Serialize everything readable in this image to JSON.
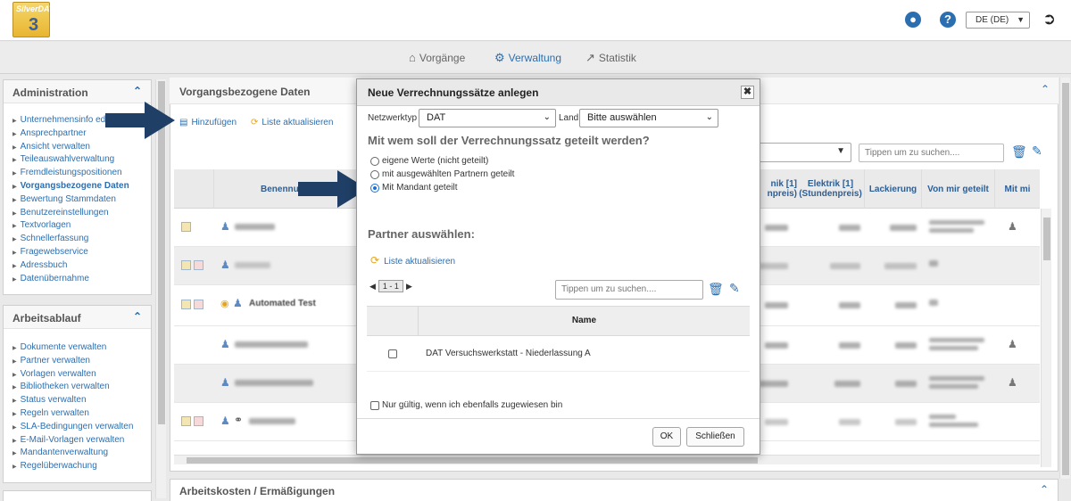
{
  "app": {
    "logo_text": "SilverDAT",
    "logo_number": "3",
    "language": "DE (DE)"
  },
  "nav": {
    "items": [
      "Vorgänge",
      "Verwaltung",
      "Statistik"
    ],
    "active": "Verwaltung"
  },
  "sidebar": {
    "administration": {
      "title": "Administration",
      "items": [
        "Unternehmensinfo editieren",
        "Ansprechpartner",
        "Ansicht verwalten",
        "Teileauswahlverwaltung",
        "Fremdleistungspositionen",
        "Vorgangsbezogene Daten",
        "Bewertung Stammdaten",
        "Benutzereinstellungen",
        "Textvorlagen",
        "Schnellerfassung",
        "Fragewebservice",
        "Adressbuch",
        "Datenübernahme"
      ],
      "active": "Vorgangsbezogene Daten"
    },
    "arbeitsablauf": {
      "title": "Arbeitsablauf",
      "items": [
        "Dokumente verwalten",
        "Partner verwalten",
        "Vorlagen verwalten",
        "Bibliotheken verwalten",
        "Status verwalten",
        "Regeln verwalten",
        "SLA-Bedingungen verwalten",
        "E-Mail-Vorlagen verwalten",
        "Mandantenverwaltung",
        "Regelüberwachung"
      ]
    }
  },
  "main": {
    "title": "Vorgangsbezogene Daten",
    "add_label": "Hinzufügen",
    "refresh_label": "Liste aktualisieren",
    "search_placeholder": "Tippen um zu suchen....",
    "columns": [
      "Benennung",
      "Elektrik [1] (Stundenpreis)",
      "Lackierung",
      "Von mir geteilt",
      "Mit mi"
    ],
    "col_partial": [
      "nik [1]",
      "npreis)"
    ],
    "row3_name": "Automated Test"
  },
  "bottom_panel": {
    "title": "Arbeitskosten / Ermäßigungen"
  },
  "modal": {
    "title": "Neue Verrechnungssätze anlegen",
    "netzwerktyp_label": "Netzwerktyp",
    "netzwerktyp_value": "DAT",
    "land_label": "Land",
    "land_value": "Bitte auswählen",
    "question": "Mit wem soll der Verrechnungssatz geteilt werden?",
    "options": [
      "eigene Werte (nicht geteilt)",
      "mit ausgewählten Partnern geteilt",
      "Mit Mandant geteilt"
    ],
    "selected_option": 2,
    "partner_heading": "Partner auswählen:",
    "refresh_label": "Liste aktualisieren",
    "pager": "1 - 1",
    "search_placeholder": "Tippen um zu suchen....",
    "table_header": "Name",
    "rows": [
      "DAT Versuchswerkstatt - Niederlassung A"
    ],
    "only_valid_label": "Nur gültig, wenn ich ebenfalls zugewiesen bin",
    "ok_label": "OK",
    "close_label": "Schließen"
  },
  "colors": {
    "accent": "#2c6fb0",
    "arrow": "#1f3f66",
    "icon_orange": "#e3a521"
  }
}
